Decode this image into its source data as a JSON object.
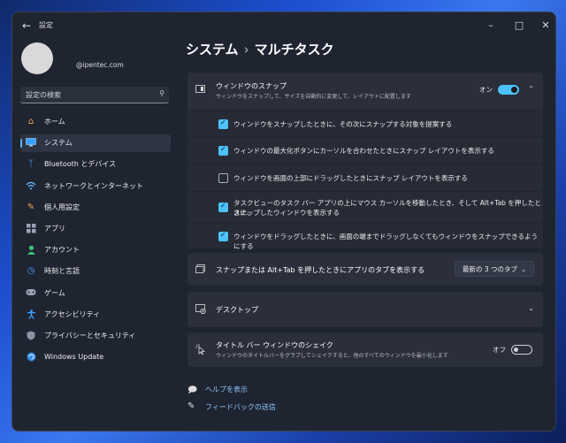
{
  "window": {
    "title": "設定"
  },
  "account": {
    "email": "@ipentec.com"
  },
  "search": {
    "placeholder": "設定の検索"
  },
  "sidebar": {
    "items": [
      {
        "label": "ホーム",
        "icon": "home-icon"
      },
      {
        "label": "システム",
        "icon": "monitor-icon",
        "selected": true
      },
      {
        "label": "Bluetooth とデバイス",
        "icon": "bluetooth-icon"
      },
      {
        "label": "ネットワークとインターネット",
        "icon": "wifi-icon"
      },
      {
        "label": "個人用設定",
        "icon": "brush-icon"
      },
      {
        "label": "アプリ",
        "icon": "apps-icon"
      },
      {
        "label": "アカウント",
        "icon": "person-icon"
      },
      {
        "label": "時刻と言語",
        "icon": "clock-globe-icon"
      },
      {
        "label": "ゲーム",
        "icon": "gamepad-icon"
      },
      {
        "label": "アクセシビリティ",
        "icon": "accessibility-icon"
      },
      {
        "label": "プライバシーとセキュリティ",
        "icon": "shield-icon"
      },
      {
        "label": "Windows Update",
        "icon": "update-icon"
      }
    ]
  },
  "breadcrumb": {
    "parent": "システム",
    "separator": "›",
    "current": "マルチタスク"
  },
  "snap": {
    "title": "ウィンドウのスナップ",
    "description": "ウィンドウをスナップして、サイズを自動的に変更して、レイアウトに配置します",
    "toggle_label": "オン",
    "toggle_on": true,
    "options": [
      {
        "label": "ウィンドウをスナップしたときに、その次にスナップする対象を提案する",
        "checked": true
      },
      {
        "label": "ウィンドウの最大化ボタンにカーソルを合わせたときにスナップ レイアウトを表示する",
        "checked": true
      },
      {
        "label": "ウィンドウを画面の上部にドラッグしたときにスナップ レイアウトを表示する",
        "checked": false
      },
      {
        "label_line1": "タスクビューのタスク バー アプリの上にマウス カーソルを移動したとき、そして Alt+Tab を押したときに、",
        "label_line2": "スナップしたウィンドウを表示する",
        "checked": true
      },
      {
        "label": "ウィンドウをドラッグしたときに、画面の端までドラッグしなくてもウィンドウをスナップできるようにする",
        "checked": true
      }
    ]
  },
  "alttab": {
    "title": "スナップまたは Alt+Tab を押したときにアプリのタブを表示する",
    "dropdown_value": "最新の 3 つのタブ"
  },
  "desktop": {
    "title": "デスクトップ"
  },
  "shake": {
    "title": "タイトル バー ウィンドウのシェイク",
    "description": "ウィンドウのタイトルバーをグラブしてシェイクすると、他のすべてのウィンドウを最小化します",
    "toggle_label": "オフ",
    "toggle_on": false
  },
  "links": {
    "help": "ヘルプを表示",
    "feedback": "フィードバックの送信"
  },
  "colors": {
    "accent": "#4cc2ff",
    "link": "#8ec9ff",
    "window_bg": "#1f2431"
  }
}
